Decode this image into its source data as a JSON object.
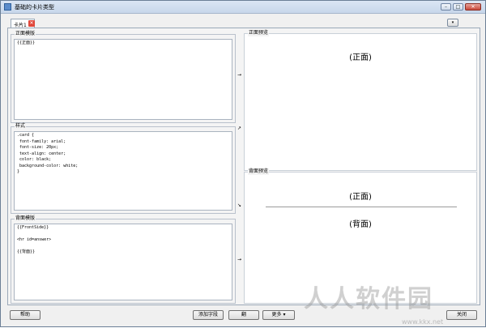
{
  "window": {
    "title": "基础的卡片类型",
    "minimize_label": "–",
    "maximize_label": "□",
    "close_label": "✕"
  },
  "tabs": [
    {
      "label": "卡片1",
      "close_label": "✕"
    }
  ],
  "options_button": {
    "label": "▾"
  },
  "front_template": {
    "label": "正面模版",
    "content": "{{正面}}"
  },
  "styling": {
    "label": "样式",
    "content": ".card {\n font-family: arial;\n font-size: 20px;\n text-align: center;\n color: black;\n background-color: white;\n}"
  },
  "back_template": {
    "label": "背面模版",
    "content": "{{FrontSide}}\n\n<hr id=answer>\n\n{{背面}}"
  },
  "arrows": {
    "front": "→",
    "style_up": "↗",
    "style_down": "↘",
    "back": "→"
  },
  "front_preview": {
    "label": "正面预览",
    "text": "(正面)"
  },
  "back_preview": {
    "label": "背面预览",
    "question_text": "(正面)",
    "answer_text": "(背面)"
  },
  "buttons": {
    "help": "帮助",
    "add_field": "添加字段",
    "flip": "翻",
    "more": "更多 ▾",
    "close": "关闭"
  },
  "watermark": {
    "text": "人人软件园",
    "url": "www.kkx.net"
  }
}
